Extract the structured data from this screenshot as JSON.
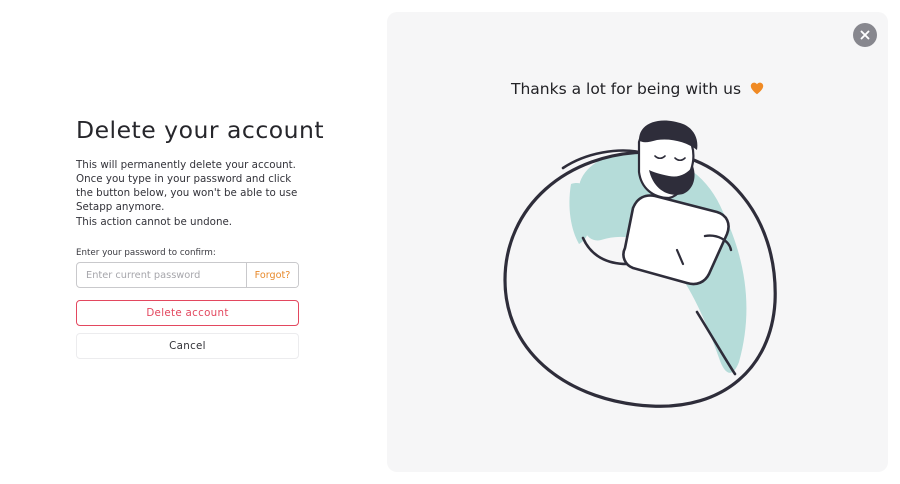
{
  "dialog": {
    "title": "Delete your account",
    "description": "This will permanently delete your account. Once you type in your password and click the button below, you won't be able to use Setapp anymore.",
    "warning": "This action cannot be undone.",
    "password_label": "Enter your password to confirm:",
    "password_placeholder": "Enter current password",
    "password_value": "",
    "forgot_label": "Forgot?",
    "delete_label": "Delete account",
    "cancel_label": "Cancel"
  },
  "panel": {
    "thanks_text": "Thanks a lot for being with us",
    "heart_icon": "heart-icon",
    "close_icon": "close-icon",
    "illustration": "man-hugging-beanbag-with-laptop"
  },
  "colors": {
    "accent_orange": "#e88a2c",
    "danger_red": "#e3485f",
    "illustration_teal": "#b5dcd9",
    "outline_dark": "#2e2d3a",
    "panel_bg": "#f6f6f7",
    "close_button_bg": "#87878e"
  }
}
